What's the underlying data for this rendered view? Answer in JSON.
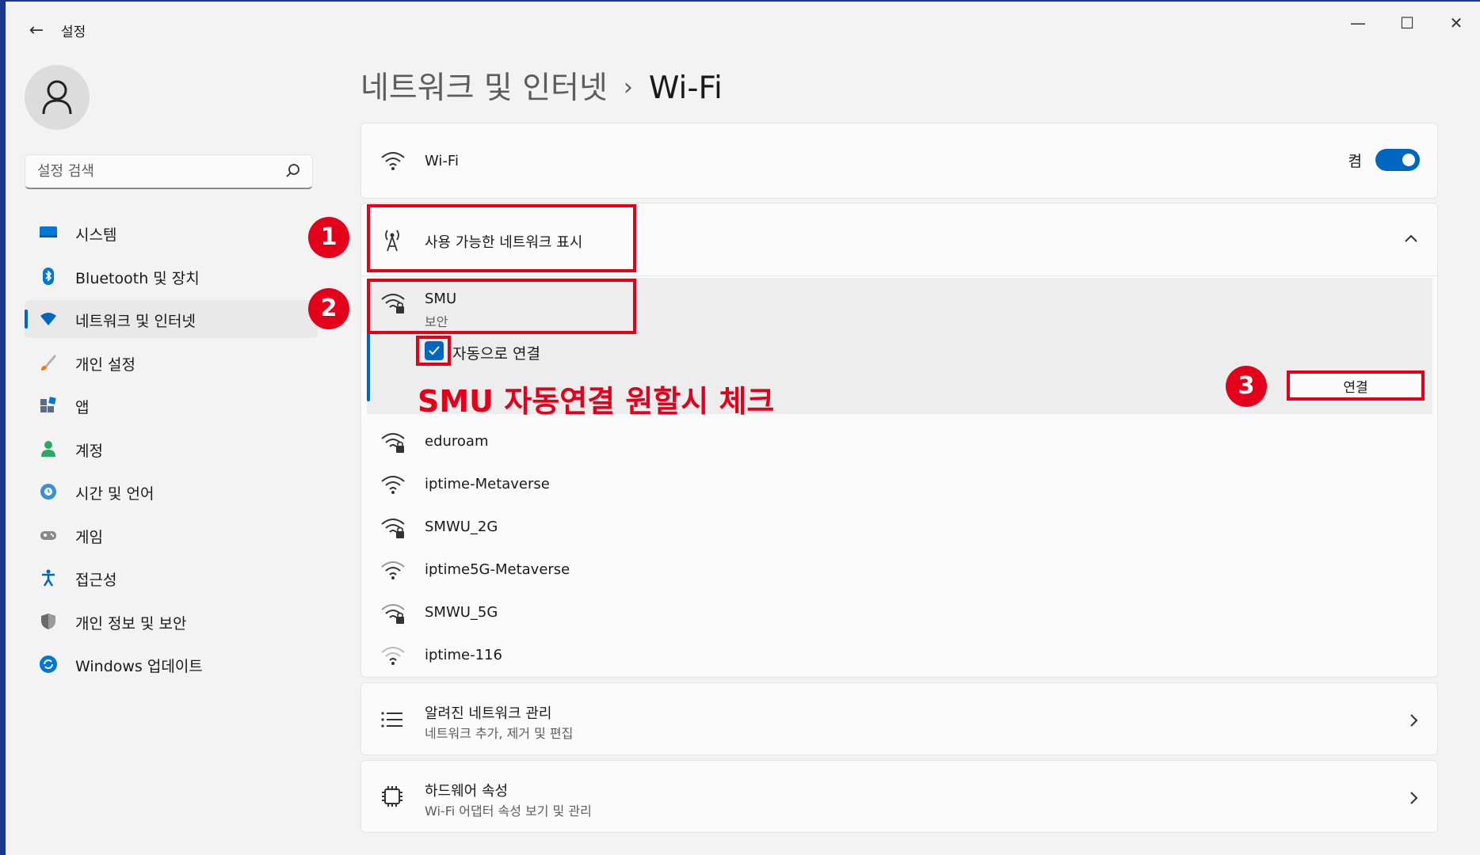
{
  "window": {
    "title": "설정",
    "back_glyph": "←",
    "controls": {
      "minimize": "—",
      "maximize": "☐",
      "close": "✕"
    }
  },
  "sidebar": {
    "search_placeholder": "설정 검색",
    "items": [
      {
        "label": "시스템",
        "icon": "monitor-icon",
        "color": "#0078d4"
      },
      {
        "label": "Bluetooth 및 장치",
        "icon": "bluetooth-icon",
        "color": "#0078d4"
      },
      {
        "label": "네트워크 및 인터넷",
        "icon": "wifi-diamond-icon",
        "color": "#0067c0",
        "active": true
      },
      {
        "label": "개인 설정",
        "icon": "brush-icon",
        "color": "#e97b1c"
      },
      {
        "label": "앱",
        "icon": "apps-icon",
        "color": "#5d6b8a"
      },
      {
        "label": "계정",
        "icon": "person-icon",
        "color": "#2aa866"
      },
      {
        "label": "시간 및 언어",
        "icon": "globe-clock-icon",
        "color": "#3a8fd6"
      },
      {
        "label": "게임",
        "icon": "gamepad-icon",
        "color": "#7a7a7a"
      },
      {
        "label": "접근성",
        "icon": "accessibility-icon",
        "color": "#0067c0"
      },
      {
        "label": "개인 정보 및 보안",
        "icon": "shield-icon",
        "color": "#6b6b6b"
      },
      {
        "label": "Windows 업데이트",
        "icon": "update-icon",
        "color": "#0078d4"
      }
    ]
  },
  "breadcrumb": {
    "parent": "네트워크 및 인터넷",
    "separator": "›",
    "current": "Wi-Fi"
  },
  "wifi_card": {
    "label": "Wi-Fi",
    "toggle_state": "켬",
    "toggle_on": true
  },
  "networks_card": {
    "header": "사용 가능한 네트워크 표시",
    "selected": {
      "ssid": "SMU",
      "security": "보안",
      "auto_connect_label": "자동으로 연결",
      "auto_connect_checked": true,
      "connect_button": "연결"
    },
    "list": [
      {
        "ssid": "eduroam",
        "secured": true
      },
      {
        "ssid": "iptime-Metaverse",
        "secured": false
      },
      {
        "ssid": "SMWU_2G",
        "secured": true
      },
      {
        "ssid": "iptime5G-Metaverse",
        "secured": false
      },
      {
        "ssid": "SMWU_5G",
        "secured": true
      },
      {
        "ssid": "iptime-116",
        "secured": false
      }
    ]
  },
  "known_networks": {
    "title": "알려진 네트워크 관리",
    "subtitle": "네트워크 추가, 제거 및 편집"
  },
  "hardware": {
    "title": "하드웨어 속성",
    "subtitle": "Wi-Fi 어댑터 속성 보기 및 관리"
  },
  "annotations": {
    "badge1": "1",
    "badge2": "2",
    "badge3": "3",
    "note": "SMU 자동연결 원할시 체크",
    "color": "#e3001b"
  },
  "colors": {
    "accent": "#0067c0",
    "background": "#f3f3f3",
    "card": "#fbfbfb"
  }
}
